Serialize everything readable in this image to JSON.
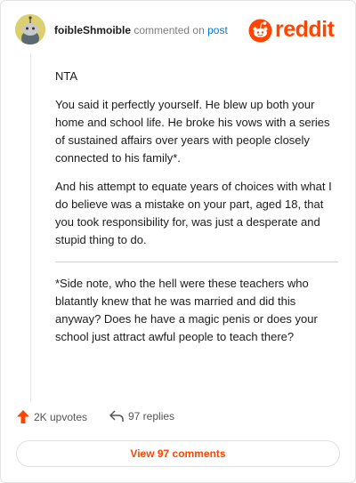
{
  "header": {
    "username": "foibleShmoible",
    "commented_on": "commented on",
    "post_link": "post",
    "brand": "reddit"
  },
  "comment": {
    "paragraphs": [
      "NTA",
      "You said it perfectly yourself. He blew up both your home and school life. He broke his vows with a series of sustained affairs over years with people closely connected to his family*.",
      "And his attempt to equate years of choices with what I do believe was a mistake on your part, aged 18, that you took responsibility for, was just a desperate and stupid thing to do.",
      "*Side note, who the hell were these teachers who blatantly knew that he was married and did this anyway? Does he have a magic penis or does your school just attract awful people to teach there?"
    ]
  },
  "actions": {
    "upvotes": "2K upvotes",
    "replies": "97 replies"
  },
  "footer": {
    "view_comments": "View 97 comments"
  },
  "colors": {
    "brand": "#ff4500",
    "link": "#0079d3"
  },
  "icons": [
    "avatar-icon",
    "reddit-logo-icon",
    "upvote-icon",
    "reply-icon"
  ]
}
